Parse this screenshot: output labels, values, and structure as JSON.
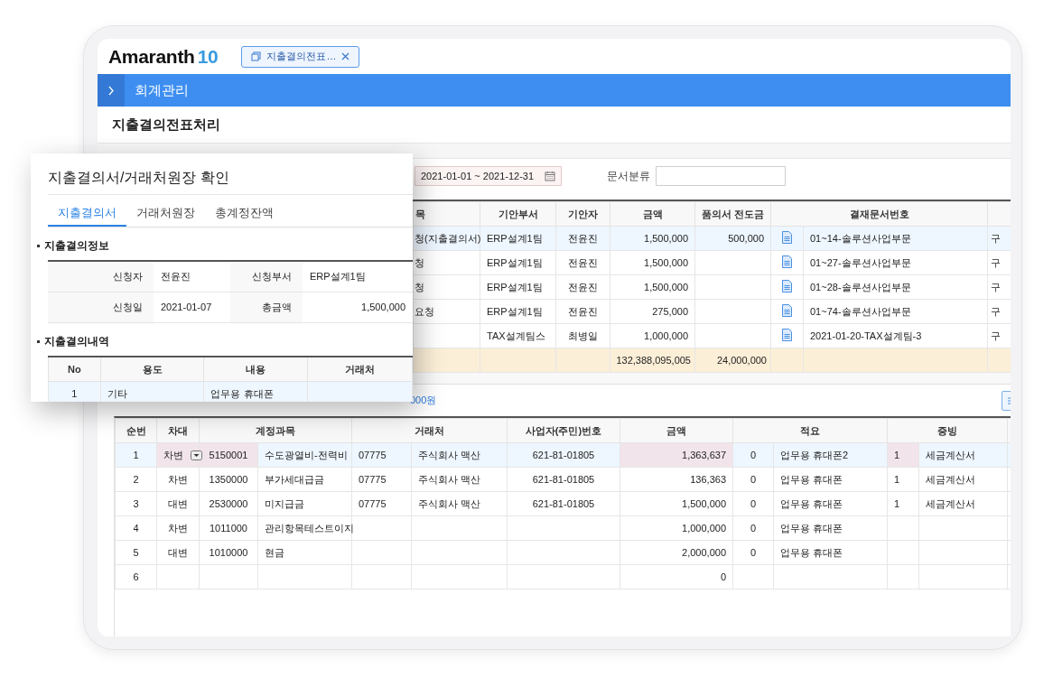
{
  "header": {
    "logo_text": "Amaranth",
    "logo_version": "10",
    "open_tab": "지출결의전표…"
  },
  "menu_bar": {
    "title": "회계관리"
  },
  "page_title": "지출결의전표처리",
  "search": {
    "date_range": "2021-01-01 ~ 2021-12-31",
    "doc_type_label": "문서분류"
  },
  "top_table": {
    "columns": [
      "목",
      "기안부서",
      "기안자",
      "금액",
      "품의서 전도금",
      "결재문서번호"
    ],
    "rows": [
      {
        "column_1": "청(지출결의서)",
        "dept": "ERP설계1팀",
        "drafter": "전윤진",
        "amount": "1,500,000",
        "advance": "500,000",
        "doc_no": "01~14-솔루션사업부문",
        "column_8": "구",
        "selected": true
      },
      {
        "column_1": "청",
        "dept": "ERP설계1팀",
        "drafter": "전윤진",
        "amount": "1,500,000",
        "doc_no": "01~27-솔루션사업부문",
        "column_8": "구",
        "selected": false
      },
      {
        "column_1": "청",
        "dept": "ERP설계1팀",
        "drafter": "전윤진",
        "amount": "1,500,000",
        "doc_no": "01~28-솔루션사업부문",
        "column_8": "구",
        "selected": false
      },
      {
        "column_1": "요청",
        "dept": "ERP설계1팀",
        "drafter": "전윤진",
        "amount": "275,000",
        "doc_no": "01~74-솔루션사업부문",
        "column_8": "구",
        "selected": false
      },
      {
        "dept": "TAX설계팀스",
        "drafter": "최병일",
        "amount": "1,000,000",
        "doc_no": "2021-01-20-TAX설계팀-3",
        "column_8": "구",
        "selected": false
      }
    ],
    "totals": {
      "amount": "132,388,095,005",
      "advance": "24,000,000"
    }
  },
  "amount_note": "000원",
  "bottom_table": {
    "columns": [
      "순번",
      "차대",
      "계정과목",
      "거래처",
      "사업자(주민)번호",
      "금액",
      "적요",
      "증빙"
    ],
    "rows": [
      {
        "no": "1",
        "side": "차변",
        "acct_code": "5150001",
        "acct_name": "수도광열비-전력비",
        "vendor_code": "07775",
        "vendor_name": "주식회사 맥산",
        "biz_no": "621-81-01805",
        "amount": "1,363,637",
        "memo_code": "0",
        "memo": "업무용 휴대폰2",
        "proof_no": "1",
        "proof": "세금계산서",
        "selected": true
      },
      {
        "no": "2",
        "side": "차변",
        "acct_code": "1350000",
        "acct_name": "부가세대급금",
        "vendor_code": "07775",
        "vendor_name": "주식회사 맥산",
        "biz_no": "621-81-01805",
        "amount": "136,363",
        "memo_code": "0",
        "memo": "업무용 휴대폰",
        "proof_no": "1",
        "proof": "세금계산서",
        "selected": false
      },
      {
        "no": "3",
        "side": "대변",
        "acct_code": "2530000",
        "acct_name": "미지급금",
        "vendor_code": "07775",
        "vendor_name": "주식회사 맥산",
        "biz_no": "621-81-01805",
        "amount": "1,500,000",
        "memo_code": "0",
        "memo": "업무용 휴대폰",
        "proof_no": "1",
        "proof": "세금계산서",
        "selected": false
      },
      {
        "no": "4",
        "side": "차변",
        "acct_code": "1011000",
        "acct_name": "관리항목테스트이지",
        "amount": "1,000,000",
        "memo_code": "0",
        "memo": "업무용 휴대폰",
        "selected": false
      },
      {
        "no": "5",
        "side": "대변",
        "acct_code": "1010000",
        "acct_name": "현금",
        "amount": "2,000,000",
        "memo_code": "0",
        "memo": "업무용 휴대폰",
        "selected": false
      },
      {
        "no": "6",
        "amount": "0",
        "selected": false
      }
    ]
  },
  "popup": {
    "title": "지출결의서/거래처원장 확인",
    "tabs": [
      {
        "label": "지출결의서",
        "selected": true
      },
      {
        "label": "거래처원장",
        "selected": false
      },
      {
        "label": "총계정잔액",
        "selected": false
      }
    ],
    "info_section": "지출결의정보",
    "info": [
      {
        "label": "신청자",
        "value": "전윤진"
      },
      {
        "label": "신청부서",
        "value": "ERP설계1팀"
      },
      {
        "label": "신청일",
        "value": "2021-01-07"
      },
      {
        "label": "총금액",
        "value": "1,500,000"
      }
    ],
    "detail_section": "지출결의내역",
    "detail_table": {
      "columns": [
        "No",
        "용도",
        "내용",
        "거래처"
      ],
      "rows": [
        {
          "no": "1",
          "use": "기타",
          "content": "업무용 휴대폰",
          "selected": true
        }
      ]
    }
  }
}
